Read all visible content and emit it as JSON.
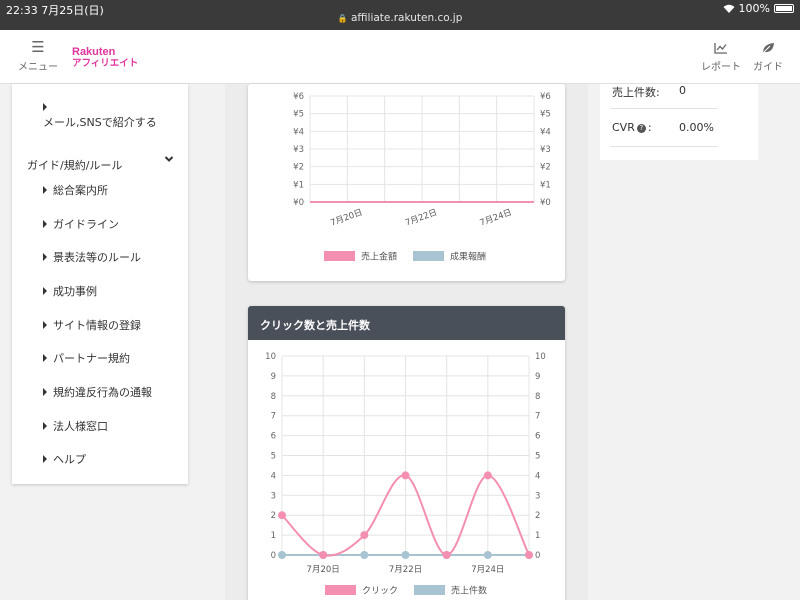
{
  "status_bar": {
    "time": "22:33 7月25日(日)",
    "url": "affiliate.rakuten.co.jp",
    "battery": "100%"
  },
  "header": {
    "menu_label": "メニュー",
    "logo_line1": "Rakuten",
    "logo_line2": "アフィリエイト",
    "report_label": "レポート",
    "guide_label": "ガイド",
    "brand_color": "#e0359e"
  },
  "sidebar": {
    "share_item": "メール,SNSで紹介する",
    "section_title": "ガイド/規約/ルール",
    "items": [
      "総合案内所",
      "ガイドライン",
      "景表法等のルール",
      "成功事例",
      "サイト情報の登録",
      "パートナー規約",
      "規約違反行為の通報",
      "法人様窓口",
      "ヘルプ"
    ]
  },
  "stats": {
    "sales_count_label": "売上件数:",
    "sales_count_value": "0",
    "cvr_label": "CVR",
    "cvr_suffix": ":",
    "cvr_value": "0.00%"
  },
  "chart_data": [
    {
      "type": "line",
      "title": "",
      "x": [
        "7月19日",
        "7月20日",
        "7月21日",
        "7月22日",
        "7月23日",
        "7月24日",
        "7月25日"
      ],
      "x_tick_labels": [
        "7月20日",
        "7月22日",
        "7月24日"
      ],
      "y_tick_labels": [
        "¥0",
        "¥1",
        "¥2",
        "¥3",
        "¥4",
        "¥5",
        "¥6"
      ],
      "ylim": [
        0,
        6
      ],
      "series": [
        {
          "name": "売上金額",
          "color": "#f48fb1",
          "values": [
            0,
            0,
            0,
            0,
            0,
            0,
            0
          ]
        },
        {
          "name": "成果報酬",
          "color": "#a8c4d2",
          "values": [
            0,
            0,
            0,
            0,
            0,
            0,
            0
          ]
        }
      ],
      "grid": true,
      "legend": "bottom"
    },
    {
      "type": "line",
      "title": "クリック数と売上件数",
      "x": [
        "7月19日",
        "7月20日",
        "7月21日",
        "7月22日",
        "7月23日",
        "7月24日",
        "7月25日"
      ],
      "x_tick_labels": [
        "7月20日",
        "7月22日",
        "7月24日"
      ],
      "ylim": [
        0,
        10
      ],
      "series": [
        {
          "name": "クリック",
          "color": "#f48fb1",
          "values": [
            2,
            0,
            1,
            4,
            0,
            4,
            0
          ]
        },
        {
          "name": "売上件数",
          "color": "#a8c4d2",
          "values": [
            0,
            0,
            0,
            0,
            0,
            0,
            0
          ]
        }
      ],
      "grid": true,
      "legend": "bottom"
    }
  ]
}
